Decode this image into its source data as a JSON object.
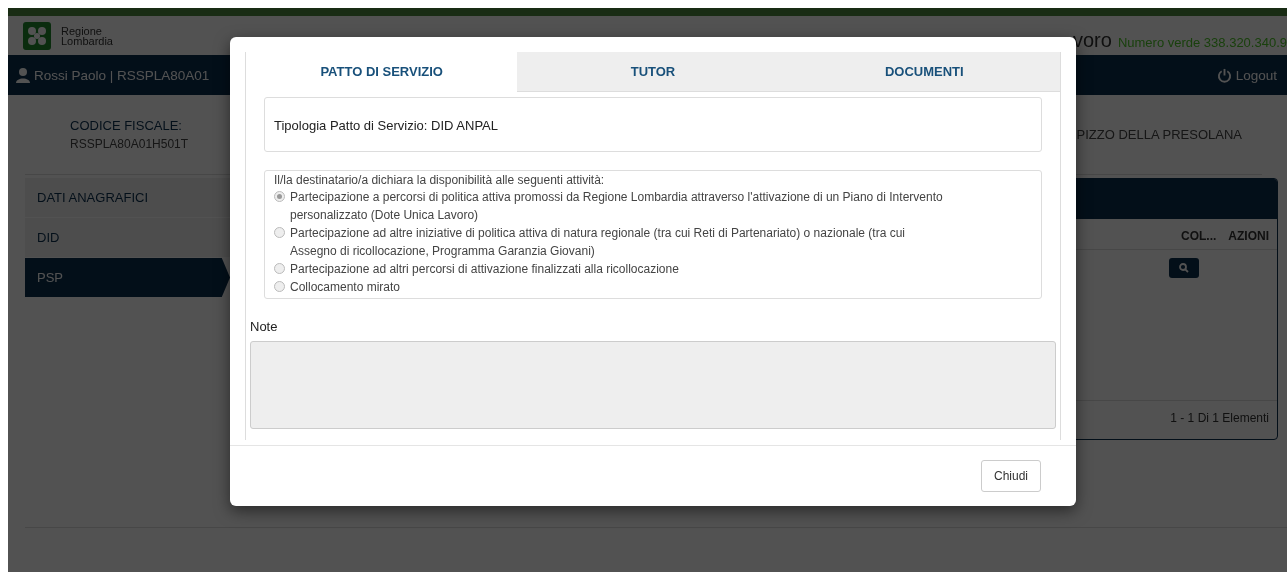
{
  "header": {
    "logo_lines": [
      "Regione",
      "Lombardia"
    ],
    "app_title": "voro",
    "phone": "Numero verde 338.320.340.9"
  },
  "navbar": {
    "user": "Rossi Paolo | RSSPLA80A01",
    "logout": "Logout"
  },
  "profile": {
    "label": "CODICE FISCALE:",
    "value": "RSSPLA80A01H501T",
    "address": "PIZZO DELLA PRESOLANA"
  },
  "sidebar": {
    "items": [
      {
        "label": "DATI ANAGRAFICI",
        "selected": false
      },
      {
        "label": "DID",
        "selected": false
      },
      {
        "label": "PSP",
        "selected": true
      }
    ]
  },
  "table": {
    "columns": [
      "COL...",
      "AZIONI"
    ],
    "pagination": "1 - 1 Di 1 Elementi"
  },
  "dialog": {
    "tabs": [
      {
        "label": "PATTO DI SERVIZIO",
        "selected": true
      },
      {
        "label": "TUTOR",
        "selected": false
      },
      {
        "label": "DOCUMENTI",
        "selected": false
      }
    ],
    "service_type": "Tipologia Patto di Servizio: DID ANPAL",
    "availability": {
      "label": "Il/la destinatario/a dichiara la disponibilità alle seguenti attività:",
      "options": [
        {
          "label": "Partecipazione a percorsi di politica attiva promossi da Regione Lombardia attraverso l'attivazione di un Piano di Intervento personalizzato (Dote Unica Lavoro)",
          "selected": true
        },
        {
          "label": "Partecipazione ad altre iniziative di politica attiva di natura regionale (tra cui Reti di Partenariato) o nazionale (tra cui Assegno di ricollocazione, Programma Garanzia Giovani)",
          "selected": false
        },
        {
          "label": "Partecipazione ad altri percorsi di attivazione finalizzati alla ricollocazione",
          "selected": false
        },
        {
          "label": "Collocamento mirato",
          "selected": false
        }
      ]
    },
    "note": {
      "label": "Note",
      "disabled": true
    },
    "buttons": [
      "Chiudi"
    ]
  }
}
